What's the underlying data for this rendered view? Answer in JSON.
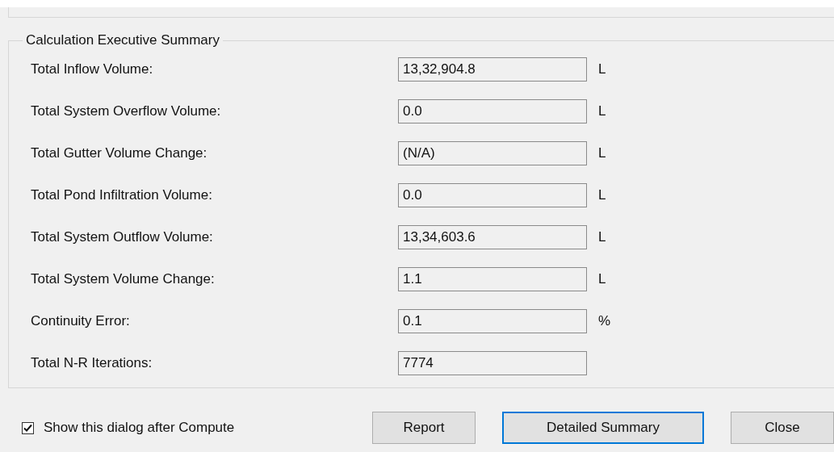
{
  "group": {
    "title": "Calculation Executive Summary",
    "rows": [
      {
        "label": "Total Inflow Volume:",
        "value": "13,32,904.8",
        "unit": "L"
      },
      {
        "label": "Total System Overflow Volume:",
        "value": "0.0",
        "unit": "L"
      },
      {
        "label": "Total Gutter Volume Change:",
        "value": "(N/A)",
        "unit": "L"
      },
      {
        "label": "Total Pond Infiltration Volume:",
        "value": "0.0",
        "unit": "L"
      },
      {
        "label": "Total System Outflow Volume:",
        "value": "13,34,603.6",
        "unit": "L"
      },
      {
        "label": "Total System Volume Change:",
        "value": "1.1",
        "unit": "L"
      },
      {
        "label": "Continuity Error:",
        "value": "0.1",
        "unit": "%"
      },
      {
        "label": "Total N-R Iterations:",
        "value": "7774"
      }
    ]
  },
  "show_after_compute": {
    "label": "Show this dialog after Compute",
    "checked": true
  },
  "buttons": [
    {
      "label": "Report",
      "focused": false
    },
    {
      "label": "Detailed Summary",
      "focused": true
    },
    {
      "label": "Close",
      "focused": false
    }
  ]
}
